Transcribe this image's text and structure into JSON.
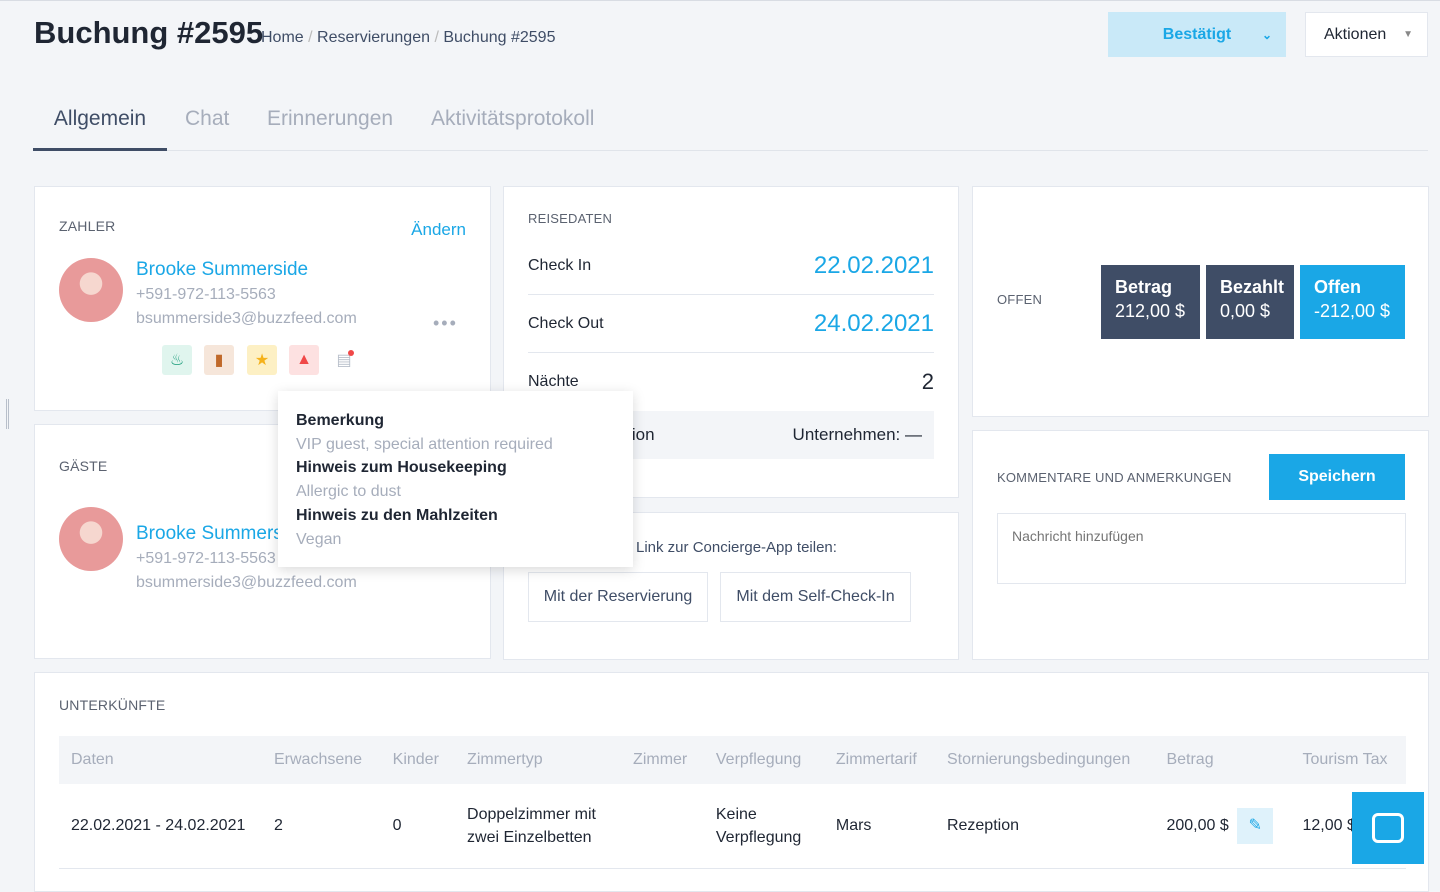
{
  "header": {
    "title": "Buchung #2595",
    "breadcrumb": [
      "Home",
      "Reservierungen",
      "Buchung #2595"
    ],
    "status": "Bestätigt",
    "actions": "Aktionen"
  },
  "tabs": [
    {
      "label": "Allgemein",
      "active": true
    },
    {
      "label": "Chat"
    },
    {
      "label": "Erinnerungen"
    },
    {
      "label": "Aktivitätsprotokoll"
    }
  ],
  "payer": {
    "label": "ZAHLER",
    "edit": "Ändern",
    "name": "Brooke Summerside",
    "phone": "+591-972-113-5563",
    "email": "bsummerside3@buzzfeed.com"
  },
  "guests": {
    "label": "GÄSTE",
    "name": "Brooke Summerside",
    "phone": "+591-972-113-5563",
    "email": "bsummerside3@buzzfeed.com"
  },
  "tooltip": {
    "items": [
      {
        "title": "Bemerkung",
        "text": "VIP guest, special attention required"
      },
      {
        "title": "Hinweis zum Housekeeping",
        "text": "Allergic to dust"
      },
      {
        "title": "Hinweis zu den Mahlzeiten",
        "text": "Vegan"
      }
    ]
  },
  "travel": {
    "label": "REISEDATEN",
    "checkin_label": "Check In",
    "checkin": "22.02.2021",
    "checkout_label": "Check Out",
    "checkout": "24.02.2021",
    "nights_label": "Nächte",
    "nights": "2",
    "source": "Rezeption",
    "company": "Unternehmen: —"
  },
  "concierge": {
    "text": "Link zur Concierge-App teilen:",
    "btn1": "Mit der Reservierung",
    "btn2": "Mit dem Self-Check-In"
  },
  "open": {
    "label": "OFFEN",
    "amount_label": "Betrag",
    "amount": "212,00 $",
    "paid_label": "Bezahlt",
    "paid": "0,00 $",
    "open_label": "Offen",
    "open": "-212,00 $"
  },
  "comments": {
    "label": "KOMMENTARE UND ANMERKUNGEN",
    "save": "Speichern",
    "placeholder": "Nachricht hinzufügen"
  },
  "units": {
    "label": "UNTERKÜNFTE",
    "columns": [
      "Daten",
      "Erwachsene",
      "Kinder",
      "Zimmertyp",
      "Zimmer",
      "Verpflegung",
      "Zimmertarif",
      "Stornierungsbedingungen",
      "Betrag",
      "Tourism Tax"
    ],
    "rows": [
      [
        "22.02.2021 - 24.02.2021",
        "2",
        "0",
        "Doppelzimmer mit zwei Einzelbetten",
        "",
        "Keine Verpflegung",
        "Mars",
        "Rezeption",
        "200,00 $",
        "12,00 $"
      ]
    ]
  },
  "colors": {
    "accent": "#1aa7e6",
    "dark": "#3f4d66"
  }
}
